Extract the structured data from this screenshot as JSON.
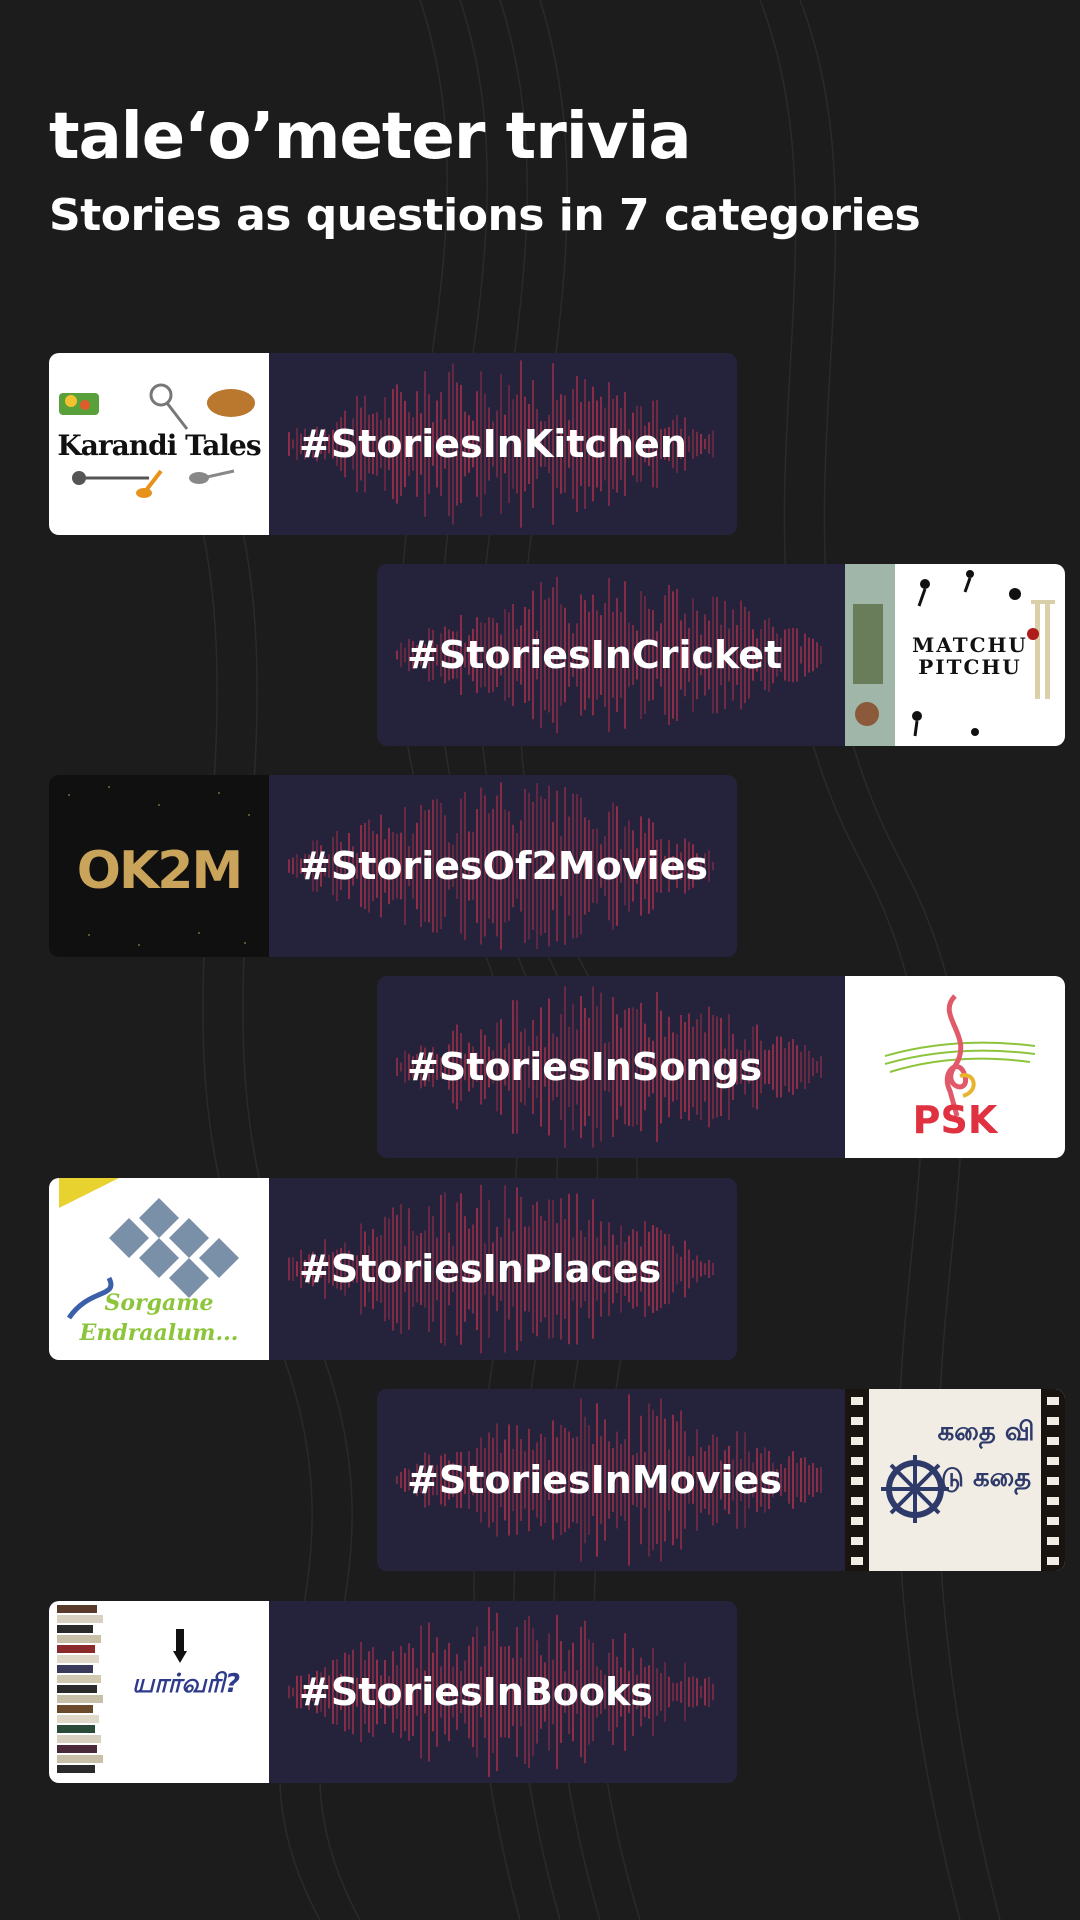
{
  "header": {
    "title": "tale‘o’meter trivia",
    "subtitle": "Stories as questions in 7 categories"
  },
  "colors": {
    "background": "#1c1c1d",
    "card": "#24233b",
    "wave": "#c0334f",
    "text": "#ffffff"
  },
  "categories": [
    {
      "label": "#StoriesInKitchen",
      "thumb_text": "Karandi Tales",
      "icon": "kitchen-utensils-icon"
    },
    {
      "label": "#StoriesInCricket",
      "thumb_text": "MATCHU PITCHU",
      "icon": "cricket-players-icon"
    },
    {
      "label": "#StoriesOf2Movies",
      "thumb_text": "OK2M",
      "icon": "marquee-lights-icon"
    },
    {
      "label": "#StoriesInSongs",
      "thumb_text": "PSK",
      "icon": "treble-clef-icon"
    },
    {
      "label": "#StoriesInPlaces",
      "thumb_text": "Sorgame Endraalum...",
      "icon": "landmarks-map-icon"
    },
    {
      "label": "#StoriesInMovies",
      "thumb_text": "கதை வி டு கதை",
      "icon": "film-reel-icon"
    },
    {
      "label": "#StoriesInBooks",
      "thumb_text": "யார்வரி?",
      "icon": "book-stack-icon"
    }
  ]
}
